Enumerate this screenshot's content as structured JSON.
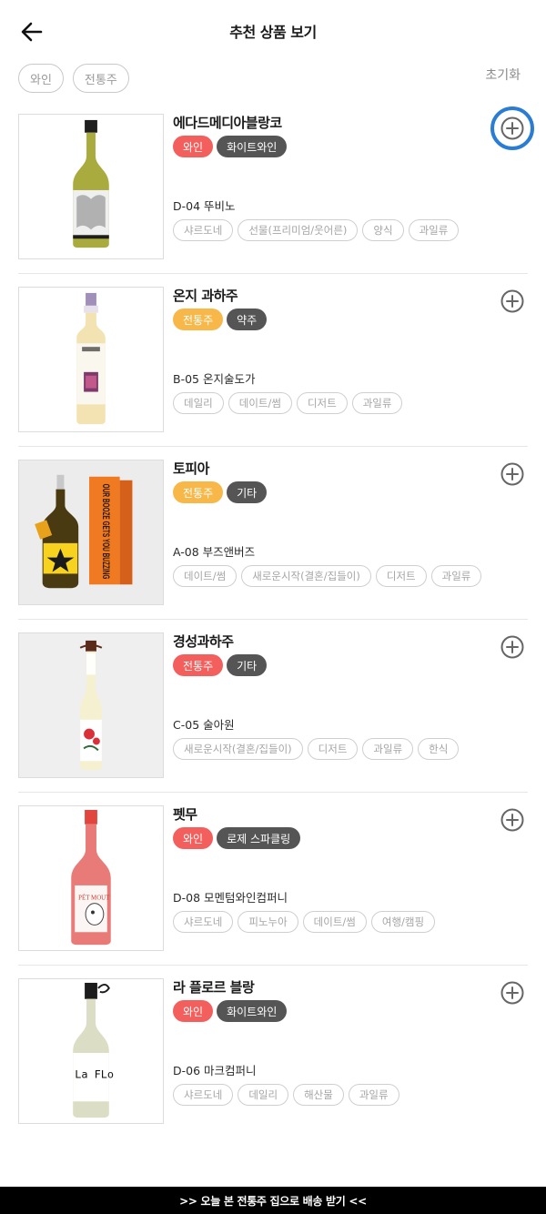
{
  "header": {
    "title": "추천 상품 보기",
    "back_icon": "arrow-left-icon"
  },
  "filters": {
    "chips": [
      "와인",
      "전통주"
    ],
    "reset_label": "초기화"
  },
  "products": [
    {
      "name": "에다드메디아블랑코",
      "badges": [
        {
          "label": "와인",
          "color": "#f25f5c"
        },
        {
          "label": "화이트와인",
          "color": "#555555"
        }
      ],
      "code": "D-04 뚜비노",
      "tags": [
        "샤르도네",
        "선물(프리미엄/웃어른)",
        "양식",
        "과일류"
      ],
      "image_icon": "white-wine-bottle-icon",
      "add_icon": "plus-circle-icon",
      "focused": true
    },
    {
      "name": "온지 과하주",
      "badges": [
        {
          "label": "전통주",
          "color": "#f8b849"
        },
        {
          "label": "약주",
          "color": "#555555"
        }
      ],
      "code": "B-05 온지술도가",
      "tags": [
        "데일리",
        "데이트/썸",
        "디저트",
        "과일류"
      ],
      "image_icon": "liquor-bottle-icon",
      "add_icon": "plus-circle-icon"
    },
    {
      "name": "토피아",
      "badges": [
        {
          "label": "전통주",
          "color": "#f8b849"
        },
        {
          "label": "기타",
          "color": "#555555"
        }
      ],
      "code": "A-08 부즈앤버즈",
      "tags": [
        "데이트/썸",
        "새로운시작(결혼/집들이)",
        "디저트",
        "과일류"
      ],
      "image_icon": "bottle-and-box-icon",
      "add_icon": "plus-circle-icon",
      "box_text": "OUR BOOZE GETS YOU BUZZING"
    },
    {
      "name": "경성과하주",
      "badges": [
        {
          "label": "전통주",
          "color": "#f25f5c"
        },
        {
          "label": "기타",
          "color": "#555555"
        }
      ],
      "code": "C-05 술아원",
      "tags": [
        "새로운시작(결혼/집들이)",
        "디저트",
        "과일류",
        "한식"
      ],
      "image_icon": "slim-bottle-icon",
      "add_icon": "plus-circle-icon"
    },
    {
      "name": "펫무",
      "badges": [
        {
          "label": "와인",
          "color": "#f25f5c"
        },
        {
          "label": "로제 스파클링",
          "color": "#555555"
        }
      ],
      "code": "D-08 모멘텀와인컴퍼니",
      "tags": [
        "샤르도네",
        "피노누아",
        "데이트/썸",
        "여행/캠핑"
      ],
      "image_icon": "rose-wine-bottle-icon",
      "add_icon": "plus-circle-icon",
      "label_text": "PÉT MOUT"
    },
    {
      "name": "라 플로르 블랑",
      "badges": [
        {
          "label": "와인",
          "color": "#f25f5c"
        },
        {
          "label": "화이트와인",
          "color": "#555555"
        }
      ],
      "code": "D-06 마크컴퍼니",
      "tags": [
        "샤르도네",
        "데일리",
        "해산물",
        "과일류"
      ],
      "image_icon": "white-wine-bottle-icon",
      "add_icon": "plus-circle-icon",
      "label_text": "La FLo"
    }
  ],
  "bottom_bar": {
    "label": ">> 오늘 본 전통주 집으로 배송 받기 <<"
  }
}
